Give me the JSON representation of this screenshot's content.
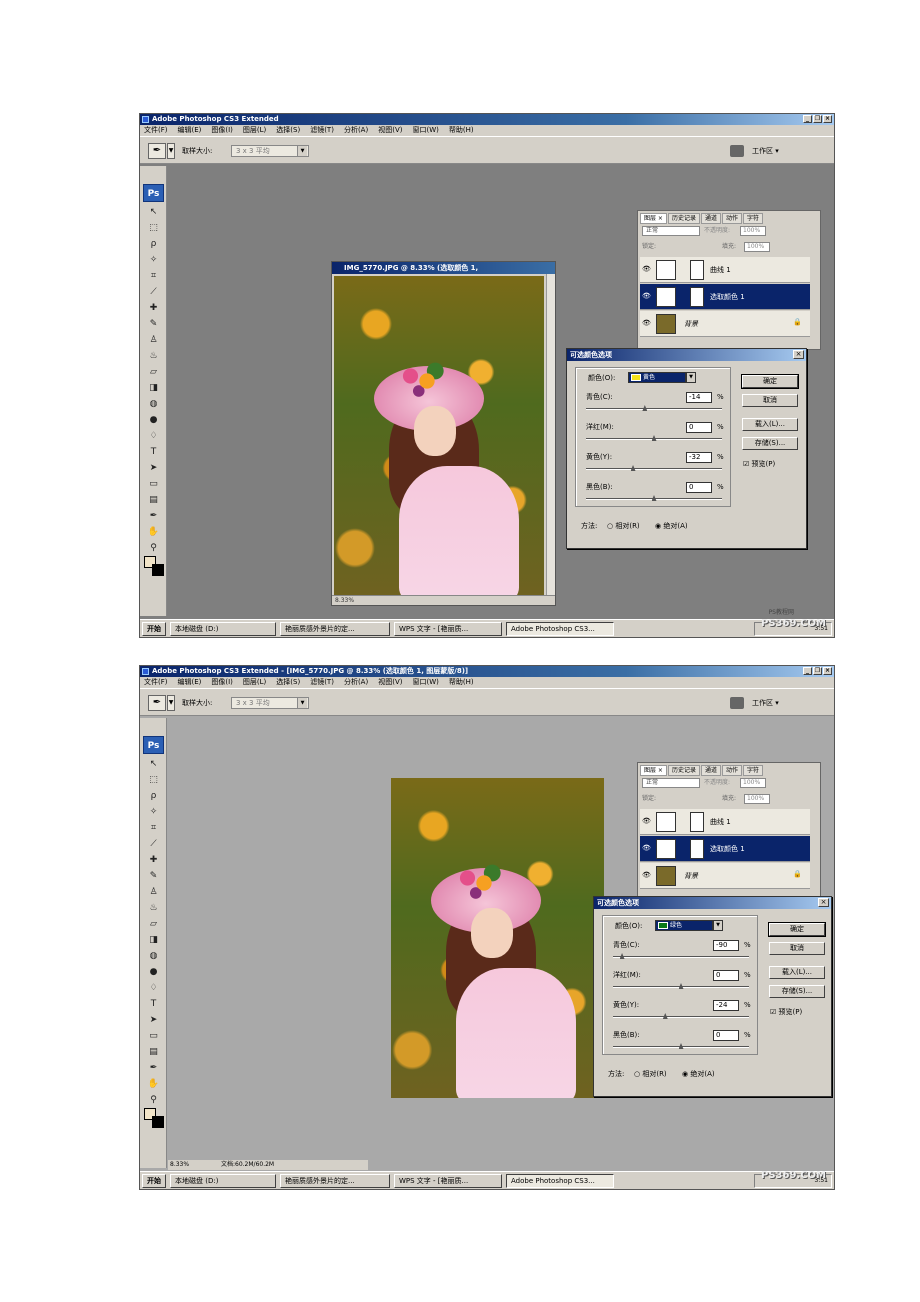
{
  "shot1": {
    "app_title": "Adobe Photoshop CS3 Extended",
    "doc_title": "IMG_5770.JPG @ 8.33% (选取颜色 1,",
    "doc_zoom": "8.33%",
    "dialog": {
      "title": "可选颜色选项",
      "color_label": "颜色(O):",
      "color_value": "黄色",
      "color_hex": "#f5e21a",
      "sliders": [
        {
          "label": "青色(C):",
          "value": "-14",
          "fraction": 0.43
        },
        {
          "label": "洋红(M):",
          "value": "0",
          "fraction": 0.5
        },
        {
          "label": "黄色(Y):",
          "value": "-32",
          "fraction": 0.34
        },
        {
          "label": "黑色(B):",
          "value": "0",
          "fraction": 0.5
        }
      ],
      "pct": "%",
      "ok": "确定",
      "cancel": "取消",
      "load": "载入(L)...",
      "save": "存储(S)...",
      "preview": "☑ 预览(P)",
      "method_label": "方法:",
      "method_relative": "○ 相对(R)",
      "method_absolute": "◉ 绝对(A)"
    }
  },
  "shot2": {
    "app_title": "Adobe Photoshop CS3 Extended - [IMG_5770.JPG @ 8.33% (选取颜色 1, 图层蒙版/8)]",
    "doc_zoom": "8.33%",
    "doc_info": "文档:60.2M/60.2M",
    "dialog": {
      "title": "可选颜色选项",
      "color_label": "颜色(O):",
      "color_value": "绿色",
      "color_hex": "#0a7a1a",
      "sliders": [
        {
          "label": "青色(C):",
          "value": "-90",
          "fraction": 0.05
        },
        {
          "label": "洋红(M):",
          "value": "0",
          "fraction": 0.5
        },
        {
          "label": "黄色(Y):",
          "value": "-24",
          "fraction": 0.38
        },
        {
          "label": "黑色(B):",
          "value": "0",
          "fraction": 0.5
        }
      ],
      "pct": "%",
      "ok": "确定",
      "cancel": "取消",
      "load": "载入(L)...",
      "save": "存储(S)...",
      "preview": "☑ 预览(P)",
      "method_label": "方法:",
      "method_relative": "○ 相对(R)",
      "method_absolute": "◉ 绝对(A)"
    }
  },
  "menu": [
    "文件(F)",
    "编辑(E)",
    "图像(I)",
    "图层(L)",
    "选择(S)",
    "滤镜(T)",
    "分析(A)",
    "视图(V)",
    "窗口(W)",
    "帮助(H)"
  ],
  "options": {
    "sample_label": "取样大小:",
    "sample_value": "3 x 3 平均",
    "workspace": "工作区 ▾"
  },
  "layers_panel": {
    "tabs": [
      "图层 ×",
      "历史记录",
      "通道",
      "动作",
      "字符"
    ],
    "blend": "正常",
    "opacity_label": "不透明度:",
    "opacity": "100%",
    "lock_label": "锁定:",
    "fill_label": "填充:",
    "fill": "100%",
    "layers": [
      {
        "name": "曲线 1"
      },
      {
        "name": "选取颜色 1"
      },
      {
        "name": "背景"
      }
    ]
  },
  "taskbar": {
    "start": "开始",
    "items": [
      "本地磁盘 (D:)",
      "艳丽质感外景片的定...",
      "WPS 文字 - [艳丽质...",
      "Adobe Photoshop CS3..."
    ],
    "clock": "3:51"
  },
  "watermark": "PS369.COM",
  "watermark_small": "PS教程网"
}
